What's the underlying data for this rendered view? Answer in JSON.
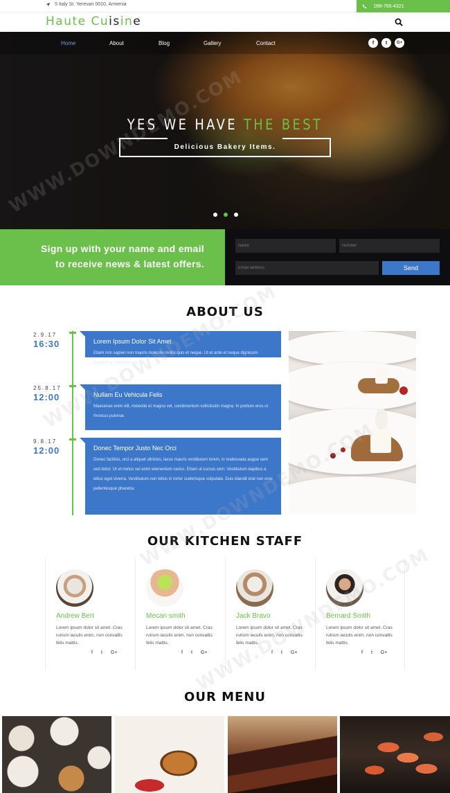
{
  "topbar": {
    "address": "5 Italy St. Yerevan 0010, Armenia",
    "phone": "098-765-4321"
  },
  "logo": {
    "part1": "Haute Cu",
    "part2": "is",
    "part3": "in",
    "part4": "e"
  },
  "nav": {
    "items": [
      "Home",
      "About",
      "Blog",
      "Gallery",
      "Contact"
    ],
    "social": [
      "f",
      "t",
      "G+"
    ]
  },
  "hero": {
    "title_white": "YES WE HAVE ",
    "title_green": "THE BEST",
    "subtitle": "Delicious Bakery Items."
  },
  "signup": {
    "line1": "Sign up with your name and email",
    "line2": "to receive news & latest offers.",
    "name_placeholder": "Name",
    "number_placeholder": "Number",
    "email_placeholder": "Email address",
    "send_label": "Send"
  },
  "about": {
    "title": "ABOUT US",
    "timeline": [
      {
        "date": "2.9.17",
        "time": "16:30",
        "heading": "Lorem Ipsum Dolor Sit Amet",
        "text": "Etiam non sapien non mauris molestie mollis quis et neque. Ut et ante et neque dignissim tincidunt a interdum orci."
      },
      {
        "date": "25.8.17",
        "time": "12:00",
        "heading": "Nullam Eu Vehicula Felis",
        "text": "Maecenas enim elit, molestie et magna vel, condimentum sollicitudin magna. In pretium eros ut rhoncus pulvinar."
      },
      {
        "date": "9.8.17",
        "time": "12:00",
        "heading": "Donec Tempor Justo Nec Orci",
        "text": "Donec facilisis, orci a aliquet ultricies, lacus mauris vestibulum lorem, in malesuada augue sem sed dolor. Ut et metus vel enim elementum varius. Etiam ut cursus sem. Vestibulum dapibus a tellus eget viverra. Vestibulum non tellus in tortor scelerisque vulputate. Duis blandit erat non eros pellentesque pharetra."
      }
    ]
  },
  "staff": {
    "title": "OUR KITCHEN STAFF",
    "members": [
      {
        "name": "Andrew Bert",
        "bio": "Lorem ipsum dolor sit amet. Cras rutrum iaculis enim, non convallis felis mattis."
      },
      {
        "name": "Mecan smith",
        "bio": "Lorem ipsum dolor sit amet. Cras rutrum iaculis enim, non convallis felis mattis."
      },
      {
        "name": "Jack Bravo",
        "bio": "Lorem ipsum dolor sit amet. Cras rutrum iaculis enim, non convallis felis mattis."
      },
      {
        "name": "Bernard Smith",
        "bio": "Lorem ipsum dolor sit amet. Cras rutrum iaculis enim, non convallis felis mattis."
      }
    ],
    "social": [
      "f",
      "t",
      "G+"
    ]
  },
  "menu": {
    "title": "OUR MENU"
  },
  "watermark": "WWW.DOWNDEMO.COM",
  "colors": {
    "accent_green": "#6ac04a",
    "accent_blue": "#3d77c9"
  }
}
